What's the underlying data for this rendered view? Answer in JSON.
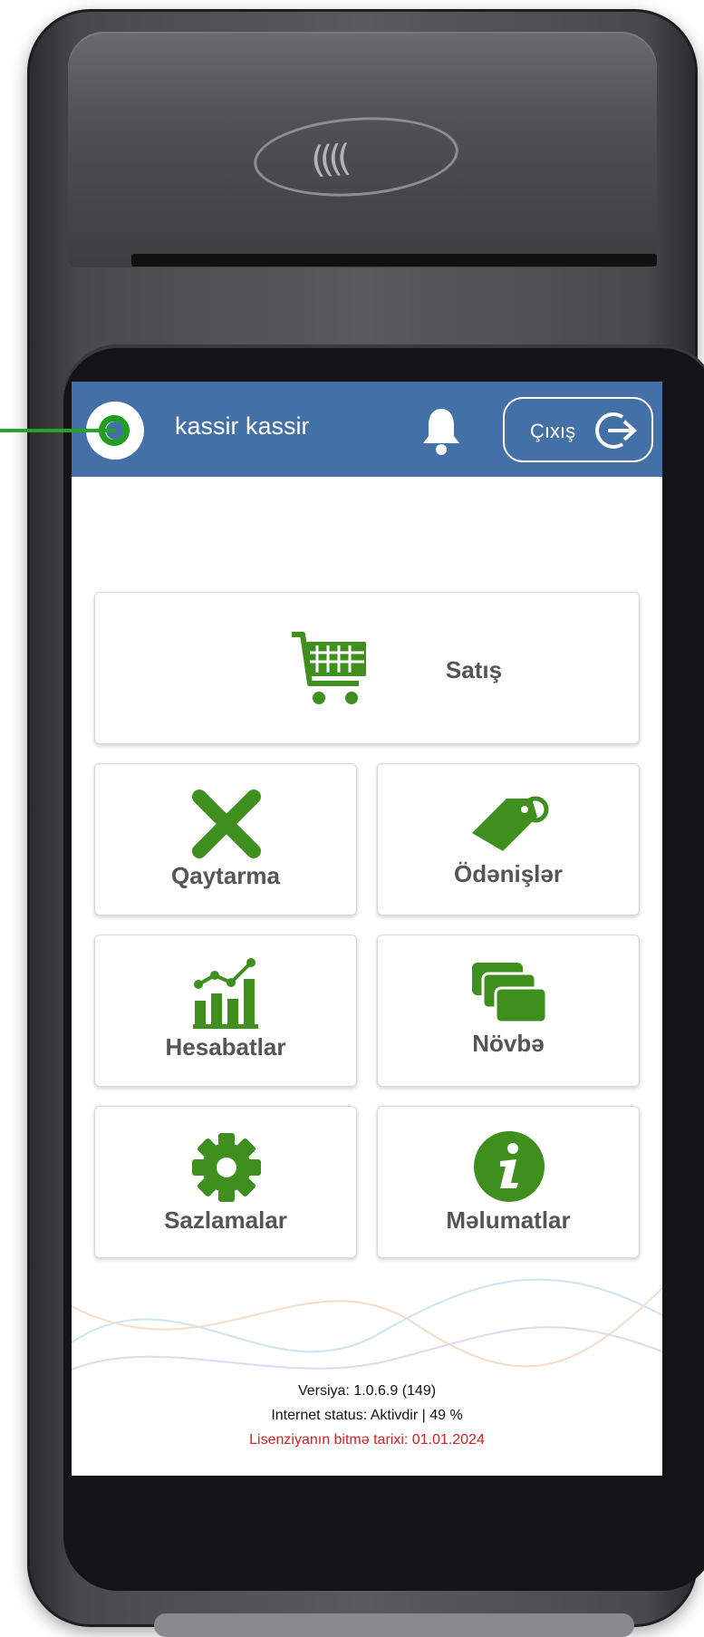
{
  "header": {
    "username": "kassir kassir",
    "logout_label": "Çıxış"
  },
  "menu": {
    "sale": "Satış",
    "refund": "Qaytarma",
    "payments": "Ödənişlər",
    "reports": "Hesabatlar",
    "shift": "Növbə",
    "settings": "Sazlamalar",
    "info": "Məlumatlar"
  },
  "footer": {
    "version": "Versiya: 1.0.6.9 (149)",
    "internet": "Internet status: Aktivdir | 49 %",
    "license": "Lisenziyanın bitmə tarixi: 01.01.2024"
  },
  "colors": {
    "header": "#4470a8",
    "icon_green": "#3f8f1f",
    "license_red": "#d42020"
  },
  "icons": [
    "avatar",
    "bell-icon",
    "logout-icon",
    "cart-icon",
    "x-icon",
    "tag-icon",
    "chart-icon",
    "cards-icon",
    "gear-icon",
    "info-icon"
  ]
}
